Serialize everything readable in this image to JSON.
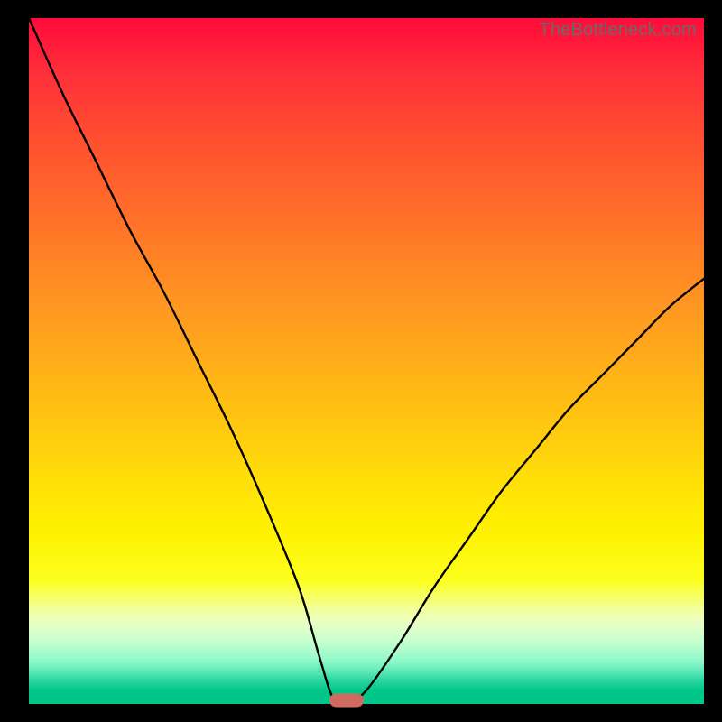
{
  "watermark": "TheBottleneck.com",
  "colors": {
    "frame": "#000000",
    "marker": "#cf6b61",
    "curve": "#000000"
  },
  "chart_data": {
    "type": "line",
    "title": "",
    "xlabel": "",
    "ylabel": "",
    "xlim": [
      0,
      100
    ],
    "ylim": [
      0,
      100
    ],
    "grid": false,
    "series": [
      {
        "name": "bottleneck-curve",
        "x": [
          0,
          5,
          10,
          15,
          20,
          25,
          30,
          35,
          40,
          43,
          45,
          47,
          50,
          55,
          60,
          65,
          70,
          75,
          80,
          85,
          90,
          95,
          100
        ],
        "y": [
          100,
          89,
          79,
          69,
          60,
          50,
          40,
          29,
          17,
          7,
          1,
          0,
          2,
          9,
          17,
          24,
          31,
          37,
          43,
          48,
          53,
          58,
          62
        ]
      }
    ],
    "marker": {
      "x": 47,
      "y": 0.5
    },
    "background_gradient_stops": [
      {
        "pos": 0,
        "color": "#ff0a3a"
      },
      {
        "pos": 0.3,
        "color": "#ff7328"
      },
      {
        "pos": 0.66,
        "color": "#ffdb0a"
      },
      {
        "pos": 0.86,
        "color": "#f1ffa4"
      },
      {
        "pos": 1.0,
        "color": "#00c789"
      }
    ]
  }
}
